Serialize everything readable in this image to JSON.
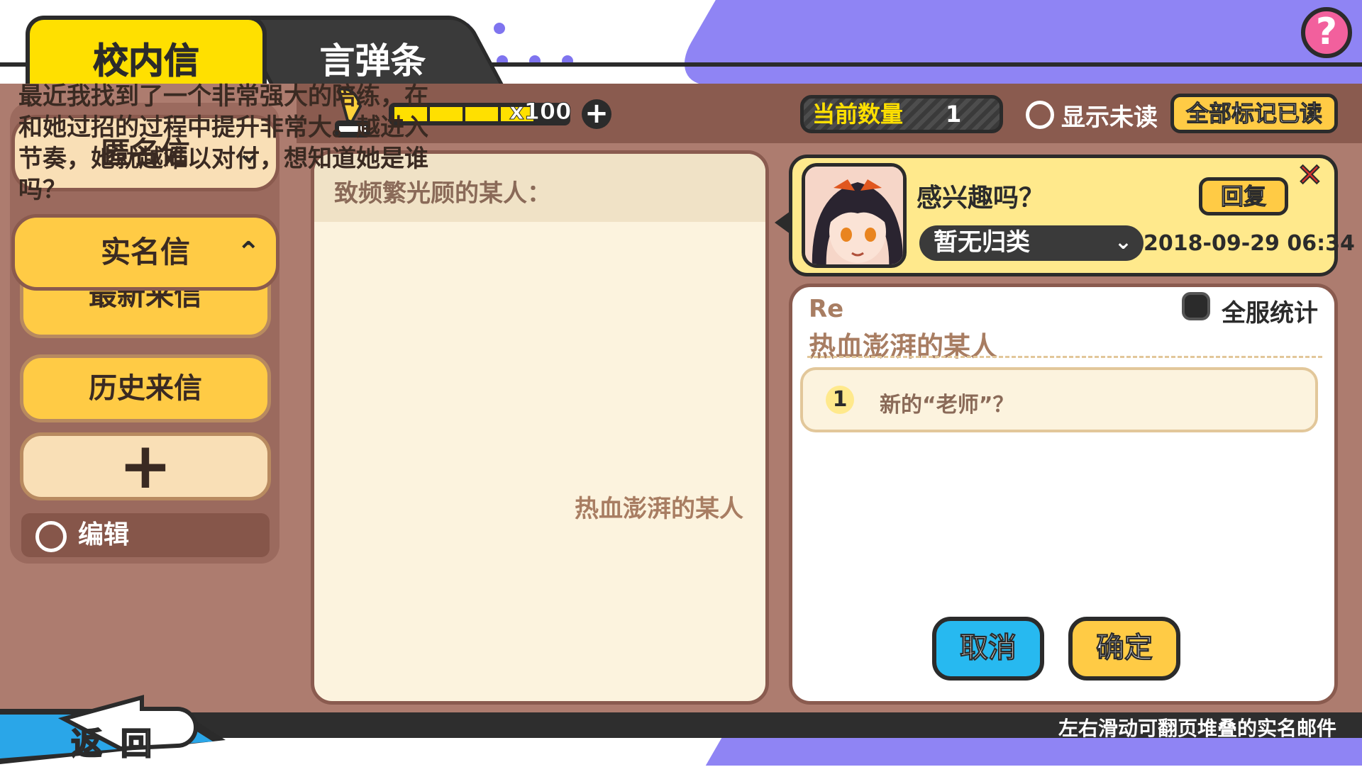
{
  "tabs": {
    "active": "校内信",
    "inactive": "言弹条"
  },
  "help_icon": "question-mark-icon",
  "sidebar": {
    "anonymous": "匿名信",
    "named": "实名信",
    "latest": "最新来信",
    "history": "历史来信",
    "add_icon": "plus-icon",
    "edit": "编辑"
  },
  "toolbar": {
    "energy_label": "x100",
    "energy_fill": 1.0,
    "count_label": "当前数量",
    "count_value": "1",
    "show_unread": "显示未读",
    "mark_all_read": "全部标记已读"
  },
  "letter": {
    "greeting": "致频繁光顾的某人：",
    "body": "最近我找到了一个非常强大的陪练，在和她过招的过程中提升非常大。越进入节奏，她就越难以对付，想知道她是谁吗？",
    "signature": "热血澎湃的某人"
  },
  "sender_card": {
    "subject": "感兴趣吗？",
    "reply": "回复",
    "category": "暂无归类",
    "datetime": "2018-09-29 06:34"
  },
  "reply_panel": {
    "re": "Re",
    "target": "热血澎湃的某人",
    "server_stats": "全服统计",
    "options": [
      {
        "num": "1",
        "text": "新的“老师”？"
      }
    ],
    "cancel": "取消",
    "confirm": "确定"
  },
  "back": {
    "char1": "返",
    "char2": "回"
  },
  "bottom_hint": "左右滑动可翻页堆叠的实名邮件",
  "colors": {
    "accent_yellow": "#ffcb45",
    "brown": "#ad7c6f",
    "blue": "#27b9f0",
    "purple": "#8f84f4"
  }
}
